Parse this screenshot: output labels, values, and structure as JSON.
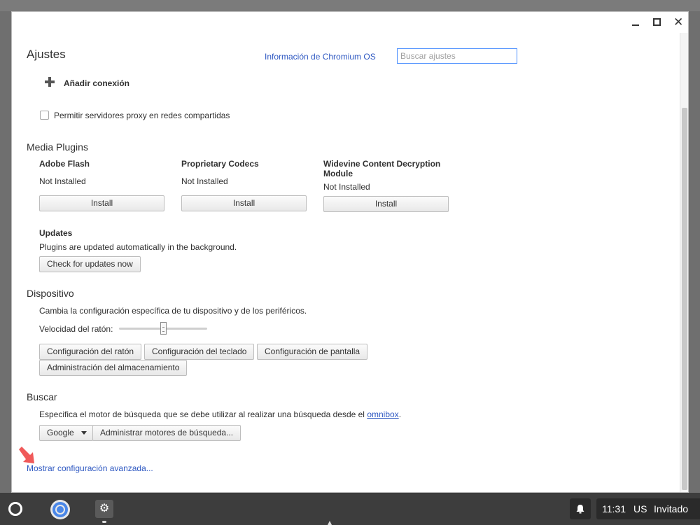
{
  "settings": {
    "title": "Ajustes",
    "about_link": "Información de Chromium OS",
    "search_placeholder": "Buscar ajustes",
    "add_connection": "Añadir conexión",
    "proxy_checkbox_label": "Permitir servidores proxy en redes compartidas",
    "proxy_checked": false
  },
  "media_plugins": {
    "heading": "Media Plugins",
    "plugins": [
      {
        "name": "Adobe Flash",
        "status": "Not Installed",
        "button": "Install"
      },
      {
        "name": "Proprietary Codecs",
        "status": "Not Installed",
        "button": "Install"
      },
      {
        "name": "Widevine Content Decryption Module",
        "status": "Not Installed",
        "button": "Install"
      }
    ],
    "updates_heading": "Updates",
    "updates_text": "Plugins are updated automatically in the background.",
    "check_updates_button": "Check for updates now"
  },
  "device": {
    "heading": "Dispositivo",
    "description": "Cambia la configuración específica de tu dispositivo y de los periféricos.",
    "mouse_speed_label": "Velocidad del ratón:",
    "mouse_speed_level": 0.5,
    "buttons": [
      "Configuración del ratón",
      "Configuración del teclado",
      "Configuración de pantalla",
      "Administración del almacenamiento"
    ]
  },
  "search": {
    "heading": "Buscar",
    "description_prefix": "Especifica el motor de búsqueda que se debe utilizar al realizar una búsqueda desde el",
    "omnibox_link": "omnibox",
    "description_suffix": ".",
    "engine_selected": "Google",
    "manage_engines_button": "Administrar motores de búsqueda..."
  },
  "advanced_link": "Mostrar configuración avanzada...",
  "window_controls": {
    "close_glyph": "✕"
  },
  "shelf": {
    "time": "11:31",
    "keyboard_layout": "US",
    "user": "Invitado"
  },
  "colors": {
    "link": "#2f59c2",
    "arrow": "#f05a5a",
    "search_focus": "#4d90fe",
    "shelf": "#3d3d3d"
  }
}
